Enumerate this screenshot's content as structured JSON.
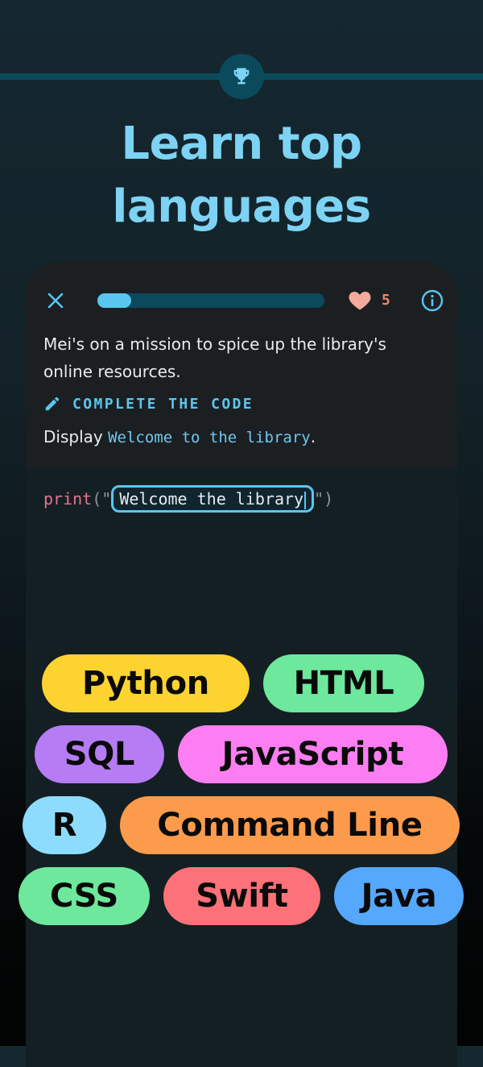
{
  "headline": {
    "line1": "Learn top",
    "line2": "languages"
  },
  "lesson": {
    "progress_fraction": 0.15,
    "lives": "5",
    "story": "Mei's on a mission to spice up the library's online resources.",
    "task_label": "COMPLETE THE CODE",
    "instruction_prefix": "Display ",
    "instruction_code": "Welcome to the library",
    "instruction_suffix": "."
  },
  "code": {
    "func": "print",
    "open": "(\"",
    "input_value": "Welcome the library",
    "close": "\")"
  },
  "languages": [
    {
      "label": "Python",
      "color": "#fdd330"
    },
    {
      "label": "HTML",
      "color": "#6de89c"
    },
    {
      "label": "SQL",
      "color": "#b57cf4"
    },
    {
      "label": "JavaScript",
      "color": "#fc7ef2"
    },
    {
      "label": "R",
      "color": "#8edcfd"
    },
    {
      "label": "Command Line",
      "color": "#fd9b4c"
    },
    {
      "label": "CSS",
      "color": "#6de89c"
    },
    {
      "label": "Swift",
      "color": "#fd7178"
    },
    {
      "label": "Java",
      "color": "#55a8fc"
    }
  ],
  "icons": {
    "trophy": "trophy-icon",
    "close": "close-icon",
    "heart": "heart-icon",
    "info": "info-icon",
    "pencil": "pencil-icon"
  },
  "colors": {
    "accent": "#5ac6f0",
    "headline": "#7dd3f3",
    "heart": "#f4846a"
  }
}
